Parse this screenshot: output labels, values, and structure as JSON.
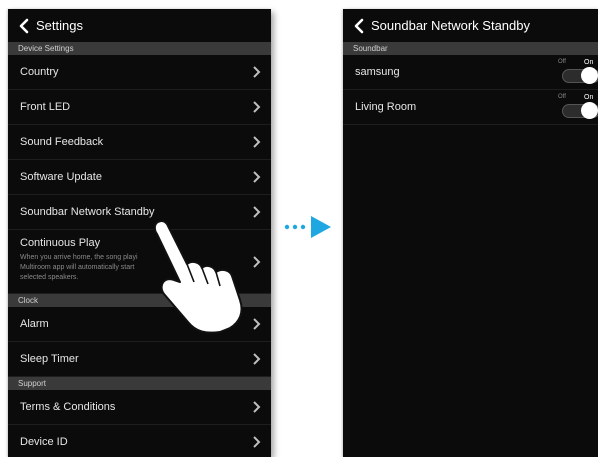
{
  "left": {
    "back_title": "Settings",
    "sections": [
      {
        "header": "Device Settings",
        "items": [
          {
            "label": "Country"
          },
          {
            "label": "Front LED"
          },
          {
            "label": "Sound Feedback"
          },
          {
            "label": "Software Update"
          },
          {
            "label": "Soundbar Network Standby"
          },
          {
            "label": "Continuous Play",
            "desc": "When you arrive home, the song playi\nMultiroom app will automatically start\nselected speakers."
          }
        ]
      },
      {
        "header": "Clock",
        "items": [
          {
            "label": "Alarm"
          },
          {
            "label": "Sleep Timer"
          }
        ]
      },
      {
        "header": "Support",
        "items": [
          {
            "label": "Terms & Conditions"
          },
          {
            "label": "Device ID"
          }
        ]
      }
    ]
  },
  "right": {
    "back_title": "Soundbar Network Standby",
    "section_header": "Soundbar",
    "items": [
      {
        "label": "samsung",
        "toggle": {
          "off_label": "Off",
          "on_label": "On",
          "state": "on"
        }
      },
      {
        "label": "Living Room",
        "toggle": {
          "off_label": "Off",
          "on_label": "On",
          "state": "on"
        }
      }
    ]
  },
  "colors": {
    "accent_arrow": "#1ea7e1",
    "background": "#0b0b0b",
    "section_header": "#3a3a3a"
  },
  "icons": [
    "chevron-left-icon",
    "chevron-right-icon",
    "pointing-hand-icon",
    "transition-arrow-icon"
  ]
}
